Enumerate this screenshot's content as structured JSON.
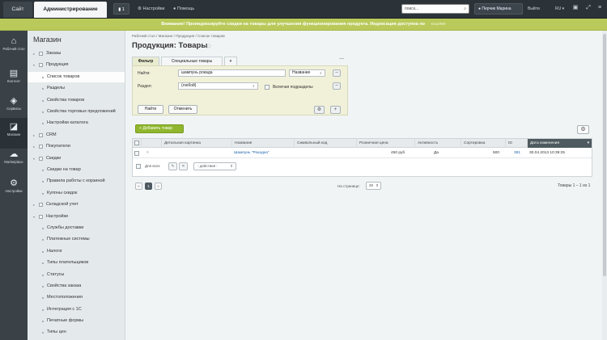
{
  "topbar": {
    "tab_site": "Сайт",
    "tab_admin": "Администрирование",
    "notifications_count": "1",
    "settings": "Настройки",
    "help": "Помощь",
    "search_placeholder": "поиск...",
    "user_name": "Перчик Марина",
    "logout": "Выйти",
    "lang": "RU"
  },
  "notice": {
    "text": "Внимание! Проиндексируйте скидки на товары для улучшения функционирования продукта. Индексация доступна по",
    "link": "ссылке"
  },
  "iconbar": {
    "items": [
      {
        "label": "Рабочий стол",
        "icon": "home-icon"
      },
      {
        "label": "Контент",
        "icon": "document-icon"
      },
      {
        "label": "Сервисы",
        "icon": "layers-icon"
      },
      {
        "label": "Магазин",
        "icon": "shop-basket-icon"
      },
      {
        "label": "Marketplace",
        "icon": "cloud-icon"
      },
      {
        "label": "Настройки",
        "icon": "gear-icon"
      }
    ]
  },
  "sidebar": {
    "title": "Магазин",
    "items": [
      {
        "label": "Заказы",
        "level": 0
      },
      {
        "label": "Продукция",
        "level": 0
      },
      {
        "label": "Список товаров",
        "level": 1
      },
      {
        "label": "Разделы",
        "level": 1
      },
      {
        "label": "Свойства товаров",
        "level": 1
      },
      {
        "label": "Свойства торговых предложений",
        "level": 1
      },
      {
        "label": "Настройки каталога",
        "level": 1
      },
      {
        "label": "CRM",
        "level": 0
      },
      {
        "label": "Покупатели",
        "level": 0
      },
      {
        "label": "Скидки",
        "level": 0
      },
      {
        "label": "Скидки на товар",
        "level": 1
      },
      {
        "label": "Правила работы с корзиной",
        "level": 1
      },
      {
        "label": "Купоны скидок",
        "level": 1
      },
      {
        "label": "Складской учет",
        "level": 0
      },
      {
        "label": "Настройки",
        "level": 0
      },
      {
        "label": "Службы доставки",
        "level": 1
      },
      {
        "label": "Платежные системы",
        "level": 1
      },
      {
        "label": "Налоги",
        "level": 1
      },
      {
        "label": "Типы плательщиков",
        "level": 1
      },
      {
        "label": "Статусы",
        "level": 1
      },
      {
        "label": "Свойства заказа",
        "level": 1
      },
      {
        "label": "Местоположения",
        "level": 1
      },
      {
        "label": "Интеграция с 1С",
        "level": 1
      },
      {
        "label": "Печатные формы",
        "level": 1
      },
      {
        "label": "Типы цен",
        "level": 1
      }
    ]
  },
  "main": {
    "breadcrumb": "Рабочий стол  /  Магазин  /  Продукция  /  Список товаров",
    "title": "Продукция: Товары"
  },
  "filter": {
    "tabs": [
      "Фильтр",
      "Специальные товары",
      "+"
    ],
    "find_label": "Найти:",
    "find_value": "шампунь рокада",
    "find_field": "Название",
    "section_label": "Раздел:",
    "section_value": "(любой)",
    "include_subsections": "Включая подразделы",
    "find_button": "Найти",
    "cancel_button": "Отменить"
  },
  "toolbar": {
    "add_button": "Добавить товар"
  },
  "table": {
    "columns": [
      "Детальная картинка",
      "Название",
      "Символьный код",
      "Розничная цена",
      "Активность",
      "Сортировка",
      "ID",
      "Дата изменения"
    ],
    "rows": [
      {
        "name": "Шампунь \"Рокадка\"",
        "code": "",
        "price": "450 руб",
        "active": "Да",
        "sort": "500",
        "id": "391",
        "date": "30.04.2013 10:39:25"
      }
    ],
    "for_all": "Для всех",
    "actions_placeholder": "- действия -"
  },
  "pagination": {
    "prev": "«",
    "current": "1",
    "next": "»",
    "per_page_label": "На странице:",
    "per_page": "20",
    "total": "Товары 1 – 1 из 1"
  }
}
